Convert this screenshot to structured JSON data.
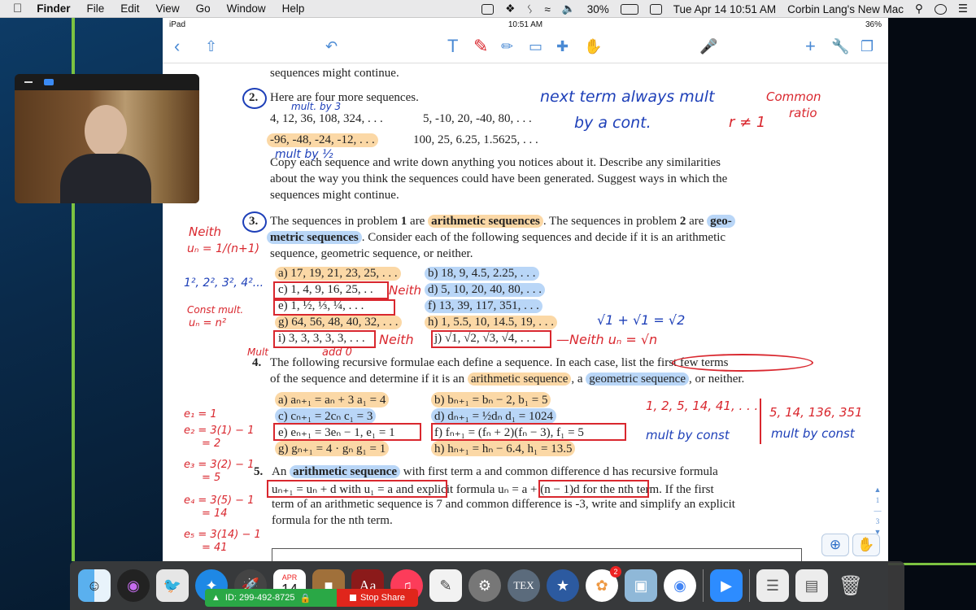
{
  "menubar": {
    "apple": "",
    "items": [
      "Finder",
      "File",
      "Edit",
      "View",
      "Go",
      "Window",
      "Help"
    ],
    "battery": "30%",
    "datetime": "Tue Apr 14  10:51 AM",
    "user": "Corbin Lang's New Mac"
  },
  "ipad": {
    "carrier": "iPad",
    "time": "10:51 AM",
    "battery": "36%"
  },
  "toolbar": {
    "icons": [
      "back-chevron",
      "share",
      "undo",
      "text-tool",
      "pen-tool",
      "highlighter-tool",
      "eraser-tool",
      "lasso-tool",
      "hand-tool",
      "microphone",
      "add",
      "wrench",
      "pages"
    ]
  },
  "doc": {
    "line_top": "sequences might continue.",
    "p2_num": "2.",
    "p2_intro": "Here are four more sequences.",
    "p2_seq_a": "4, 12, 36, 108, 324, . . .",
    "p2_seq_b": "5, -10, 20, -40, 80, . . .",
    "p2_seq_c": "-96, -48, -24, -12, . . .",
    "p2_seq_d": "100, 25, 6.25, 1.5625, . . .",
    "p2_body1": "Copy each sequence and write down anything you notices about it. Describe any similarities",
    "p2_body2": "about the way you think the sequences could have been generated. Suggest ways in which the",
    "p2_body3": "sequences might continue.",
    "p3_num": "3.",
    "p3_line1a": "The sequences in problem ",
    "p3_line1b": "1",
    "p3_line1c": " are ",
    "p3_arith": "arithmetic sequences",
    "p3_line1d": ". The sequences in problem ",
    "p3_line1e": "2",
    "p3_line1f": " are ",
    "p3_geo1": "geo-",
    "p3_geo2": "metric sequences",
    "p3_line2": ". Consider each of the following sequences and decide if it is an arithmetic",
    "p3_line3": "sequence, geometric sequence, or neither.",
    "p3_items": {
      "a": "a) 17, 19, 21, 23, 25, . . .",
      "b": "b) 18, 9, 4.5, 2.25, . . .",
      "c": "c) 1, 4, 9, 16, 25, . .",
      "d": "d) 5, 10, 20, 40, 80, . . .",
      "e": "e) 1, ½, ⅓, ¼, . . .",
      "f": "f) 13, 39, 117, 351, . . .",
      "g": "g) 64, 56, 48, 40, 32, . . .",
      "h": "h) 1, 5.5, 10, 14.5, 19, . . .",
      "i": "i) 3, 3, 3, 3, 3, . . .",
      "j": "j) √1, √2, √3, √4, . . ."
    },
    "p4_num": "4.",
    "p4_line1": "The following recursive formulae each define a sequence. In each case, list the first few terms",
    "p4_line2a": "of the sequence and determine if it is an ",
    "p4_arith": "arithmetic sequence",
    "p4_line2b": ", a ",
    "p4_geo": "geometric sequence",
    "p4_line2c": ", or neither.",
    "p4_items": {
      "a": "a) aₙ₊₁ = aₙ + 3  a₁ = 4",
      "b": "b) bₙ₊₁ = bₙ − 2, b₁ = 5",
      "c": "c) cₙ₊₁ = 2cₙ   c₁ = 3",
      "d": "d) dₙ₊₁ = ½dₙ   d₁ = 1024",
      "e": "e) eₙ₊₁ = 3eₙ − 1, e₁ = 1",
      "f": "f) fₙ₊₁ = (fₙ + 2)(fₙ − 3), f₁ = 5",
      "g": "g) gₙ₊₁ = 4 · gₙ  g₁ = 1",
      "h": "h) hₙ₊₁ = hₙ − 6.4, h₁ = 13.5"
    },
    "p5_num": "5.",
    "p5_line1a": "An ",
    "p5_arith": "arithmetic sequence",
    "p5_line1b": " with first term a and common difference d has recursive formula",
    "p5_line2": "uₙ₊₁ = uₙ + d with u₁ = a and explicit formula uₙ = a + (n − 1)d for the nth term. If the first",
    "p5_line3": "term of an arithmetic sequence is 7 and common difference is -3, write and simplify an explicit",
    "p5_line4": "formula for the nth term."
  },
  "annotations": {
    "next_term": "next term always mult",
    "by_const": "by a cont.",
    "common_ratio_1": "Common",
    "common_ratio_2": "ratio",
    "r_neq_1": "r ≠ 1",
    "mult_by_3": "mult. by 3",
    "mult_by_half": "mult by ½",
    "neith_top": "Neith",
    "un_formula": "uₙ = 1/(n+1)",
    "squares": "1², 2², 3², 4²...",
    "const_mult": "Const mult.",
    "un_n2": "uₙ = n²",
    "neith_c": "Neith",
    "neith_i": "Neith",
    "neith_j": "—Neith  uₙ = √n",
    "sqrt_note": "√1 + √1 = √2",
    "mult_label": "Mult",
    "add0_label": "add 0",
    "seq_f": "1, 2, 5, 14, 41, . . .",
    "mult_by_const_1": "mult by const",
    "seq_f2": "5, 14, 136, 351",
    "mult_by_const_2": "mult by const",
    "e_work": [
      "e₁ = 1",
      "e₂ = 3(1) − 1",
      "= 2",
      "e₃ = 3(2) − 1",
      "= 5",
      "e₄ = 3(5) − 1",
      "= 14",
      "e₅ = 3(14) − 1",
      "= 41"
    ]
  },
  "page_indicator": [
    "1",
    "—",
    "3"
  ],
  "zoom": {
    "share_id": "ID: 299-492-8725",
    "stop_share": "Stop Share"
  },
  "dock": {
    "calendar_month": "APR",
    "calendar_day": "14",
    "dictionary": "Aa",
    "tex": "TEX",
    "photos_badge": "2"
  }
}
